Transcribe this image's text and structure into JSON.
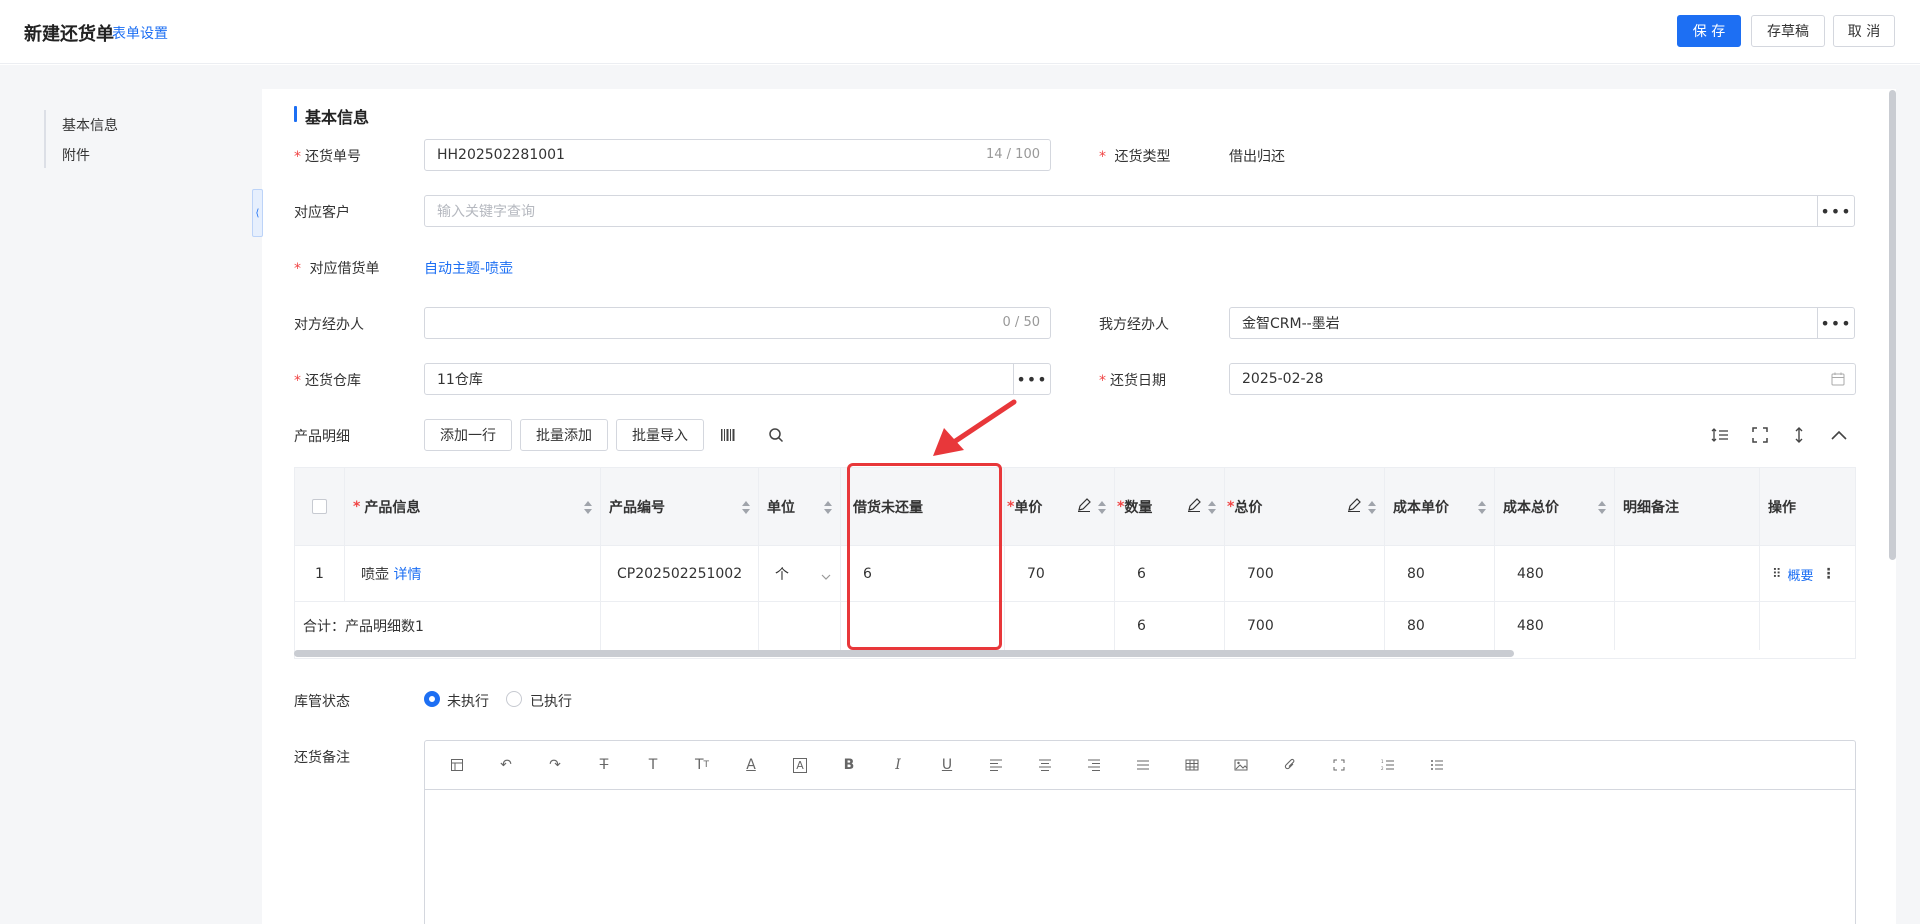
{
  "header": {
    "title": "新建还货单",
    "form_settings": "表单设置",
    "save": "保 存",
    "draft": "存草稿",
    "cancel": "取 消"
  },
  "left_nav": {
    "items": [
      "基本信息",
      "附件"
    ]
  },
  "section": {
    "title": "基本信息"
  },
  "form": {
    "return_no": {
      "label": "还货单号",
      "value": "HH202502281001",
      "counter": "14 / 100"
    },
    "return_type": {
      "label": "还货类型",
      "value": "借出归还"
    },
    "customer": {
      "label": "对应客户",
      "placeholder": "输入关键字查询"
    },
    "borrow_order": {
      "label": "对应借货单",
      "value": "自动主题-喷壶"
    },
    "their_handler": {
      "label": "对方经办人",
      "counter": "0 / 50"
    },
    "our_handler": {
      "label": "我方经办人",
      "value": "金智CRM--墨岩"
    },
    "warehouse": {
      "label": "还货仓库",
      "value": "11仓库"
    },
    "return_date": {
      "label": "还货日期",
      "value": "2025-02-28"
    },
    "product_detail": {
      "label": "产品明细"
    },
    "stock_status": {
      "label": "库管状态",
      "options": [
        "未执行",
        "已执行"
      ],
      "selected": "未执行"
    },
    "remark": {
      "label": "还货备注"
    }
  },
  "toolbar": {
    "add_row": "添加一行",
    "batch_add": "批量添加",
    "batch_import": "批量导入"
  },
  "table": {
    "headers": {
      "product_info": "产品信息",
      "product_code": "产品编号",
      "unit": "单位",
      "unreturned": "借货未还量",
      "unit_price": "单价",
      "quantity": "数量",
      "total": "总价",
      "cost_unit": "成本单价",
      "cost_total": "成本总价",
      "detail_note": "明细备注",
      "actions": "操作"
    },
    "row": {
      "index": "1",
      "product": "喷壶",
      "detail_link": "详情",
      "code": "CP202502251002",
      "unit": "个",
      "unreturned": "6",
      "unit_price": "70",
      "quantity": "6",
      "total": "700",
      "cost_unit": "80",
      "cost_total": "480",
      "summary_link": "概要"
    },
    "footer": {
      "label": "合计：产品明细数1",
      "quantity": "6",
      "total": "700",
      "cost_unit": "80",
      "cost_total": "480"
    }
  },
  "colors": {
    "accent": "#1d6ff3",
    "required": "#f04444",
    "highlight": "#e8373a"
  }
}
